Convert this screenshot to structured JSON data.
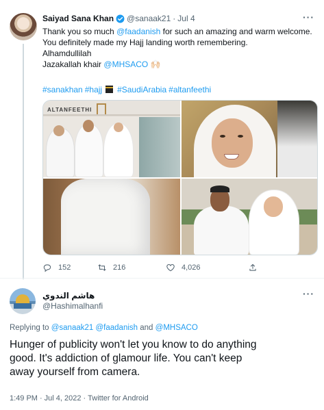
{
  "tweet1": {
    "name": "Saiyad Sana Khan",
    "handle": "@sanaak21",
    "date": "Jul 4",
    "lines": {
      "l1_a": "Thank you so much ",
      "l1_link": "@faadanish",
      "l1_b": " for such an amazing and warm welcome.",
      "l2": "You definitely made my Hajj landing worth remembering.",
      "l3": "Alhamdullilah",
      "l4_a": "Jazakallah khair ",
      "l4_link": "@MHSACO",
      "l4_emoji": "🙌🏻"
    },
    "hashtags": [
      "#sanakhan",
      "#hajj",
      "#SaudiArabia",
      "#altanfeethi"
    ],
    "photo1_sign": "ALTANFEETHI",
    "stats": {
      "replies": "152",
      "retweets": "216",
      "likes": "4,026"
    }
  },
  "tweet2": {
    "name": "هاشم الندوي",
    "handle": "@Hashimalhanfi",
    "replying_prefix": "Replying to ",
    "replying_users": [
      "@sanaak21",
      "@faadanish"
    ],
    "replying_and": " and ",
    "replying_last": "@MHSACO",
    "text_lines": [
      "Hunger of publicity won't let you know to do anything",
      "good. It's addiction of glamour life. You can't keep",
      "away yourself from camera."
    ],
    "time": "1:49 PM",
    "date": "Jul 4, 2022",
    "source": "Twitter for Android"
  },
  "colors": {
    "link": "#1d9bf0",
    "secondary_text": "#536471",
    "primary_text": "#0f1419"
  },
  "icons": [
    "verified-icon",
    "more-icon",
    "reply-icon",
    "retweet-icon",
    "like-icon",
    "share-icon"
  ]
}
